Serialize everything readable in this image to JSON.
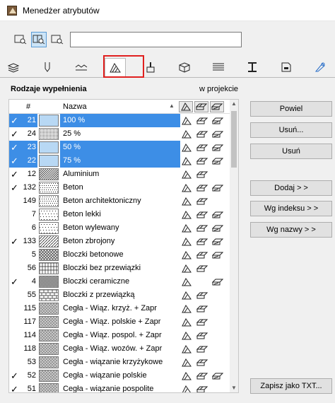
{
  "window": {
    "title": "Menedżer atrybutów"
  },
  "search": {
    "value": "",
    "placeholder": ""
  },
  "tabs": [
    {
      "icon": "layers-icon"
    },
    {
      "icon": "pen-icon"
    },
    {
      "icon": "line-type-icon"
    },
    {
      "icon": "fill-type-icon",
      "active": true
    },
    {
      "icon": "paint-icon"
    },
    {
      "icon": "building-material-icon"
    },
    {
      "icon": "composite-icon"
    },
    {
      "icon": "profile-icon"
    },
    {
      "icon": "zone-category-icon"
    },
    {
      "icon": "surface-icon"
    }
  ],
  "section": {
    "title": "Rodzaje wypełnienia",
    "subtitle": "w projekcie"
  },
  "list": {
    "col_num": "#",
    "col_name": "Nazwa",
    "sort_indicator": "▲",
    "rows": [
      {
        "check": "✓",
        "num": "21",
        "name": "100 %",
        "selected": true,
        "pattern": "solid-lightblue",
        "icons": [
          true,
          true,
          true
        ]
      },
      {
        "check": "✓",
        "num": "24",
        "name": "25 %",
        "selected": false,
        "pattern": "dots-fine",
        "icons": [
          true,
          true,
          true
        ]
      },
      {
        "check": "✓",
        "num": "23",
        "name": "50 %",
        "selected": true,
        "pattern": "light-blue",
        "icons": [
          true,
          true,
          true
        ]
      },
      {
        "check": "✓",
        "num": "22",
        "name": "75 %",
        "selected": true,
        "pattern": "light-blue",
        "icons": [
          true,
          true,
          true
        ]
      },
      {
        "check": "✓",
        "num": "12",
        "name": "Aluminium",
        "selected": false,
        "pattern": "diag",
        "icons": [
          true,
          true,
          false
        ]
      },
      {
        "check": "✓",
        "num": "132",
        "name": "Beton",
        "selected": false,
        "pattern": "dots",
        "icons": [
          true,
          true,
          true
        ]
      },
      {
        "check": "",
        "num": "149",
        "name": "Beton architektoniczny",
        "selected": false,
        "pattern": "dots",
        "icons": [
          true,
          true,
          false
        ]
      },
      {
        "check": "",
        "num": "7",
        "name": "Beton lekki",
        "selected": false,
        "pattern": "dots-sparse",
        "icons": [
          true,
          true,
          true
        ]
      },
      {
        "check": "",
        "num": "6",
        "name": "Beton wylewany",
        "selected": false,
        "pattern": "dots-sparse",
        "icons": [
          true,
          true,
          true
        ]
      },
      {
        "check": "✓",
        "num": "133",
        "name": "Beton zbrojony",
        "selected": false,
        "pattern": "diag-dots",
        "icons": [
          true,
          true,
          true
        ]
      },
      {
        "check": "",
        "num": "5",
        "name": "Bloczki betonowe",
        "selected": false,
        "pattern": "crosshatch",
        "icons": [
          true,
          true,
          true
        ]
      },
      {
        "check": "",
        "num": "56",
        "name": "Bloczki bez przewiązki",
        "selected": false,
        "pattern": "grid",
        "icons": [
          true,
          true,
          false
        ]
      },
      {
        "check": "✓",
        "num": "4",
        "name": "Bloczki ceramiczne",
        "selected": false,
        "pattern": "diag-dense",
        "icons": [
          true,
          false,
          true
        ]
      },
      {
        "check": "",
        "num": "55",
        "name": "Bloczki z przewiązką",
        "selected": false,
        "pattern": "brick",
        "icons": [
          true,
          true,
          false
        ]
      },
      {
        "check": "",
        "num": "115",
        "name": "Cegła - Wiąz. krzyż. + Zapr",
        "selected": false,
        "pattern": "brick-dense",
        "icons": [
          true,
          true,
          false
        ]
      },
      {
        "check": "",
        "num": "117",
        "name": "Cegła - Wiąz. polskie + Zapr",
        "selected": false,
        "pattern": "brick-dense",
        "icons": [
          true,
          true,
          false
        ]
      },
      {
        "check": "",
        "num": "114",
        "name": "Cegła - Wiąz. pospol. + Zapr",
        "selected": false,
        "pattern": "brick-dense",
        "icons": [
          true,
          true,
          false
        ]
      },
      {
        "check": "",
        "num": "118",
        "name": "Cegła - Wiąz. wozów. + Zapr",
        "selected": false,
        "pattern": "brick-dense",
        "icons": [
          true,
          true,
          false
        ]
      },
      {
        "check": "",
        "num": "53",
        "name": "Cegła - wiązanie krzyżykowe",
        "selected": false,
        "pattern": "brick-dense",
        "icons": [
          true,
          true,
          false
        ]
      },
      {
        "check": "✓",
        "num": "52",
        "name": "Cegła - wiązanie polskie",
        "selected": false,
        "pattern": "brick-dense",
        "icons": [
          true,
          true,
          true
        ]
      },
      {
        "check": "✓",
        "num": "51",
        "name": "Cegła - wiązanie pospolite",
        "selected": false,
        "pattern": "brick-dense",
        "icons": [
          true,
          true,
          false
        ]
      }
    ]
  },
  "buttons": {
    "powiel": "Powiel",
    "usun_dots": "Usuń...",
    "usun": "Usuń",
    "dodaj": "Dodaj > >",
    "wg_indeksu": "Wg indeksu > >",
    "wg_nazwy": "Wg nazwy > >",
    "zapisz": "Zapisz jako TXT..."
  },
  "colors": {
    "selection": "#3d8ee6",
    "highlight": "#e0201f"
  }
}
